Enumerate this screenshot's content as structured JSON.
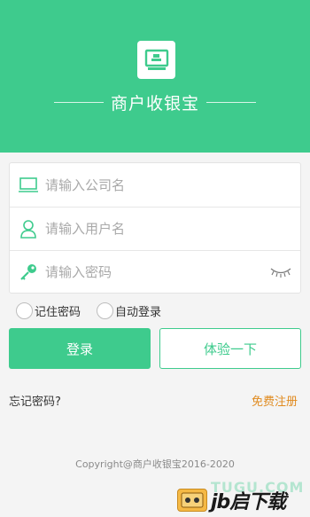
{
  "header": {
    "app_title": "商户收银宝",
    "logo_icon": "cashier-terminal-icon",
    "bg_color": "#3ecb8d"
  },
  "form": {
    "company": {
      "placeholder": "请输入公司名",
      "value": "",
      "icon": "monitor-icon"
    },
    "username": {
      "placeholder": "请输入用户名",
      "value": "",
      "icon": "user-icon"
    },
    "password": {
      "placeholder": "请输入密码",
      "value": "",
      "icon": "key-icon",
      "toggle_icon": "eye-closed-icon"
    }
  },
  "options": {
    "remember_password": {
      "label": "记住密码",
      "checked": false
    },
    "auto_login": {
      "label": "自动登录",
      "checked": false
    }
  },
  "buttons": {
    "login": "登录",
    "try": "体验一下"
  },
  "links": {
    "forgot_password": "忘记密码?",
    "register": "免费注册"
  },
  "footer": {
    "copyright": "Copyright@商户收银宝2016-2020"
  },
  "watermark": {
    "text": "jb启下载",
    "url": "TUGU.COM"
  },
  "colors": {
    "accent": "#3ecb8d",
    "link_orange": "#e08a1e"
  }
}
